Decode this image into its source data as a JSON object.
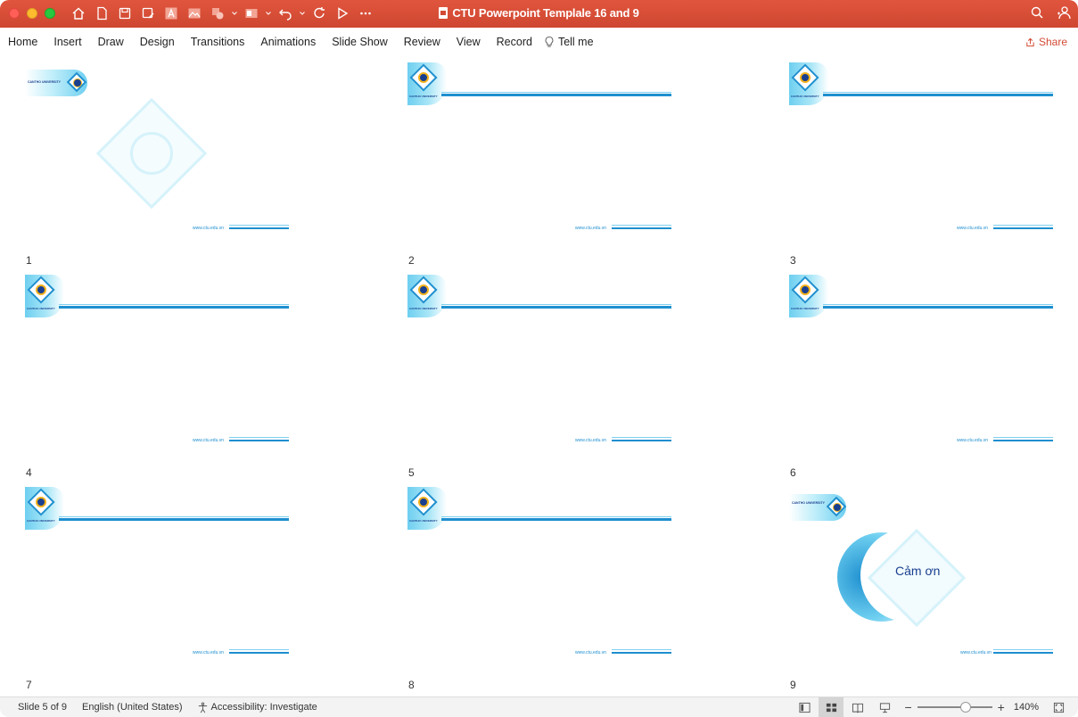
{
  "window": {
    "title": "CTU Powerpoint Templale 16 and 9"
  },
  "ribbon": {
    "tabs": [
      "Home",
      "Insert",
      "Draw",
      "Design",
      "Transitions",
      "Animations",
      "Slide Show",
      "Review",
      "View",
      "Record"
    ],
    "tell_me": "Tell me",
    "share": "Share"
  },
  "slides": [
    {
      "number": "1",
      "layout": "title",
      "footer_url": "www.ctu.edu.vn",
      "brand_text": "CANTHO UNIVERSITY"
    },
    {
      "number": "2",
      "layout": "content",
      "footer_url": "www.ctu.edu.vn",
      "brand_text": "CANTHO UNIVERSITY"
    },
    {
      "number": "3",
      "layout": "content",
      "footer_url": "www.ctu.edu.vn",
      "brand_text": "CANTHO UNIVERSITY"
    },
    {
      "number": "4",
      "layout": "content",
      "footer_url": "www.ctu.edu.vn",
      "brand_text": "CANTHO UNIVERSITY"
    },
    {
      "number": "5",
      "layout": "content",
      "footer_url": "www.ctu.edu.vn",
      "brand_text": "CANTHO UNIVERSITY"
    },
    {
      "number": "6",
      "layout": "content",
      "footer_url": "www.ctu.edu.vn",
      "brand_text": "CANTHO UNIVERSITY"
    },
    {
      "number": "7",
      "layout": "content",
      "footer_url": "www.ctu.edu.vn",
      "brand_text": "CANTHO UNIVERSITY"
    },
    {
      "number": "8",
      "layout": "content",
      "footer_url": "www.ctu.edu.vn",
      "brand_text": "CANTHO UNIVERSITY"
    },
    {
      "number": "9",
      "layout": "thanks",
      "footer_url": "www.ctu.edu.vn",
      "brand_text": "CANTHO UNIVERSITY",
      "thanks_text": "Cảm ơn"
    }
  ],
  "status": {
    "slide_position": "Slide 5 of 9",
    "language": "English (United States)",
    "accessibility": "Accessibility: Investigate",
    "zoom": "140%"
  },
  "colors": {
    "titlebar": "#d24a34",
    "accent_blue": "#1e8fcf",
    "dark_blue": "#1a3f8f"
  },
  "icons": [
    "home-icon",
    "new-file-icon",
    "save-icon",
    "save-as-icon",
    "text-icon",
    "picture-icon",
    "shapes-icon",
    "layout-icon",
    "undo-icon",
    "redo-icon",
    "play-icon",
    "more-icon",
    "search-icon",
    "account-icon",
    "lightbulb-icon",
    "share-icon",
    "accessibility-icon",
    "normal-view-icon",
    "slide-sorter-icon",
    "reading-view-icon",
    "presenter-icon",
    "zoom-out-icon",
    "zoom-in-icon",
    "fit-icon"
  ]
}
